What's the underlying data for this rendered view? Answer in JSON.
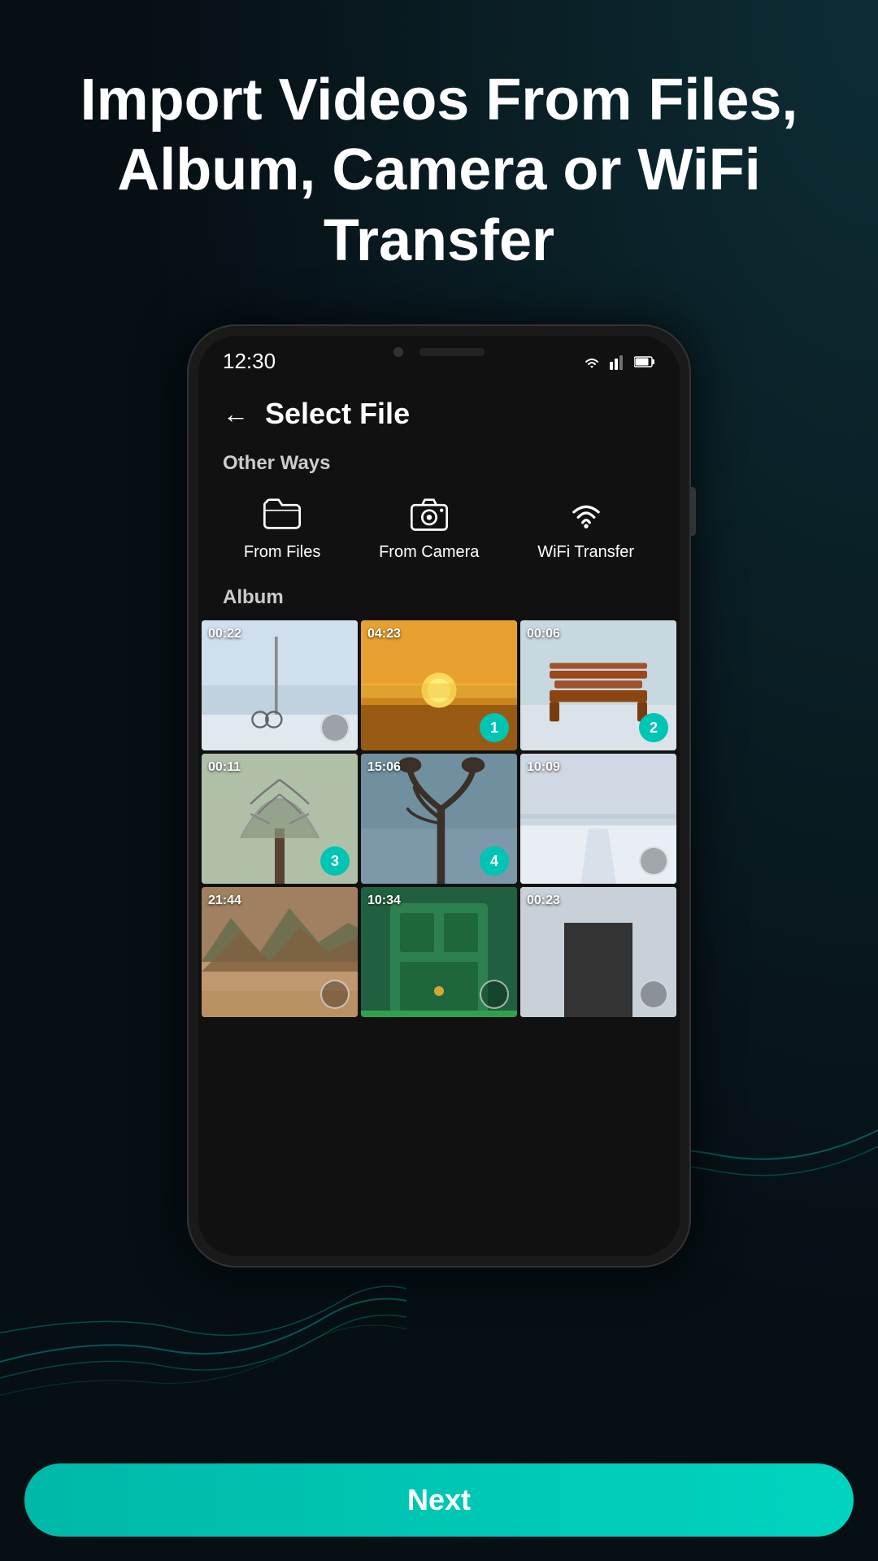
{
  "background": {
    "color": "#0a1a20"
  },
  "header": {
    "title": "Import Videos From Files, Album, Camera or WiFi Transfer"
  },
  "phone": {
    "statusBar": {
      "time": "12:30"
    },
    "screen": {
      "pageTitle": "Select File",
      "sections": {
        "otherWays": {
          "label": "Other Ways",
          "options": [
            {
              "id": "files",
              "label": "From Files",
              "icon": "folder-icon"
            },
            {
              "id": "camera",
              "label": "From Camera",
              "icon": "camera-icon"
            },
            {
              "id": "wifi",
              "label": "WiFi Transfer",
              "icon": "wifi-icon"
            }
          ]
        },
        "album": {
          "label": "Album",
          "videos": [
            {
              "id": 1,
              "duration": "00:22",
              "selection": null,
              "colorClass": "photo-1"
            },
            {
              "id": 2,
              "duration": "04:23",
              "selection": "1",
              "colorClass": "photo-2"
            },
            {
              "id": 3,
              "duration": "00:06",
              "selection": "2",
              "colorClass": "photo-3"
            },
            {
              "id": 4,
              "duration": "00:11",
              "selection": "3",
              "colorClass": "photo-4"
            },
            {
              "id": 5,
              "duration": "15:06",
              "selection": "4",
              "colorClass": "photo-5"
            },
            {
              "id": 6,
              "duration": "10:09",
              "selection": null,
              "colorClass": "photo-6"
            },
            {
              "id": 7,
              "duration": "21:44",
              "selection": null,
              "colorClass": "photo-7"
            },
            {
              "id": 8,
              "duration": "10:34",
              "selection": null,
              "colorClass": "photo-8"
            },
            {
              "id": 9,
              "duration": "00:23",
              "selection": null,
              "colorClass": "photo-9"
            }
          ]
        }
      }
    }
  },
  "footer": {
    "nextButton": "Next"
  }
}
